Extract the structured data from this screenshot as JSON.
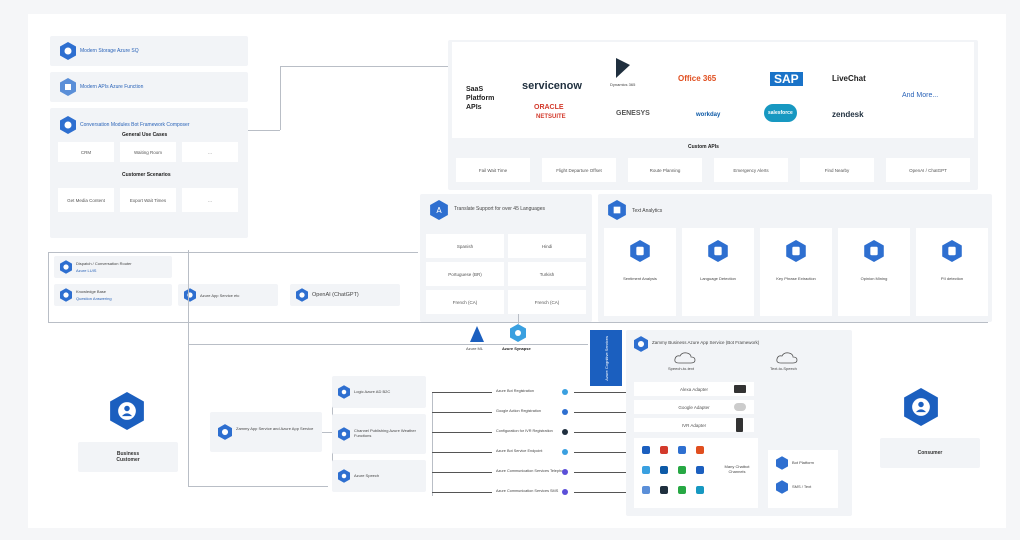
{
  "left_modules": [
    {
      "label": "Modern Storage Azure SQ"
    },
    {
      "label": "Modern APIs Azure Function"
    },
    {
      "label": "Conversation Modules Bot Framework Composer"
    }
  ],
  "general_use_cases": {
    "title": "General Use Cases",
    "items": [
      "CRM",
      "Waiting Room",
      "..."
    ]
  },
  "customer_scenarios": {
    "title": "Customer Scenarios",
    "items": [
      "Get Media Content",
      "Export Wait Times",
      "..."
    ]
  },
  "left_services": [
    {
      "label": "Dispatch / Conversation Router",
      "sub": "Azure LUIS"
    },
    {
      "label": "Knowledge Base",
      "sub": "Question Answering"
    }
  ],
  "mid_services": [
    {
      "label": "Azure App Service etc"
    },
    {
      "label": "OpenAI (ChatGPT)"
    }
  ],
  "platform_apis": {
    "title_lines": [
      "SaaS",
      "Platform",
      "APIs"
    ],
    "logos": [
      {
        "name": "servicenow",
        "color": "#1f2f3e"
      },
      {
        "name": "Dynamics 365",
        "color": "#1f2f3e"
      },
      {
        "name": "Office 365",
        "color": "#e04e1f"
      },
      {
        "name": "SAP",
        "color": "#1a73c8"
      },
      {
        "name": "LiveChat",
        "color": "#222222"
      },
      {
        "name": "ORACLE",
        "color": "#d33a2c"
      },
      {
        "name": "NETSUITE",
        "color": "#d33a2c"
      },
      {
        "name": "GENESYS",
        "color": "#555555"
      },
      {
        "name": "workday",
        "color": "#0d5aa7"
      },
      {
        "name": "salesforce",
        "color": "#1798c1"
      },
      {
        "name": "zendesk",
        "color": "#1f2f3e"
      }
    ],
    "and_more": "And More..."
  },
  "custom_apis": {
    "title": "Custom APIs",
    "items": [
      "Fail Wait Time",
      "Flight Departure Offset",
      "Route Planning",
      "Emergency Alerts",
      "Find Nearby",
      "OpenAI / ChatGPT"
    ]
  },
  "translator": {
    "title": "Translate Support for over 45 Languages",
    "languages": [
      "Spanish",
      "Hindi",
      "Portuguese (BR)",
      "Turkish",
      "French (CA)",
      "French (CA)"
    ]
  },
  "analytics": {
    "title": "Text Analytics",
    "items": [
      "Sentiment Analysis",
      "Language Detection",
      "Key Phrase Extraction",
      "Opinion Mining",
      "PII detection"
    ]
  },
  "openai_icons": [
    {
      "label": "Azure ML"
    },
    {
      "label": "Azure Synapse"
    }
  ],
  "blue_bar": {
    "text": "Azure Cognitive Services"
  },
  "bot_service": {
    "title": "Zammy Business Azure App Service (Bot Framework)",
    "speech_to_text": "Speech-to-text",
    "text_to_speech": "Text-to-Speech",
    "adapters": [
      "Alexa Adapter",
      "Google Adapter",
      "IVR Adapter"
    ],
    "channels_label": "Many Chatbot Channels",
    "side_items": [
      "Bot Platform",
      "SMS / Text"
    ]
  },
  "bottom_flow": {
    "center_label": "Zammy App Service and Azure App Service",
    "services": [
      "Logic Azure AD B2C",
      "Channel Publishing Azure Weather Functions",
      "Azure Speech"
    ],
    "registrations": [
      "Azure Bot Registration",
      "Google Action Registration",
      "Configuration for IVR Registration",
      "Azure Bot Service Endpoint",
      "Azure Communication Services Telephony",
      "Azure Communication Services SMS"
    ]
  },
  "actors": {
    "business": "Business Customer",
    "consumer": "Consumer"
  },
  "colors": {
    "accent_blue": "#1b5fbf",
    "hex_blue": "#2e6fd0",
    "panel": "#f2f4f7",
    "line": "#b9bec6"
  }
}
